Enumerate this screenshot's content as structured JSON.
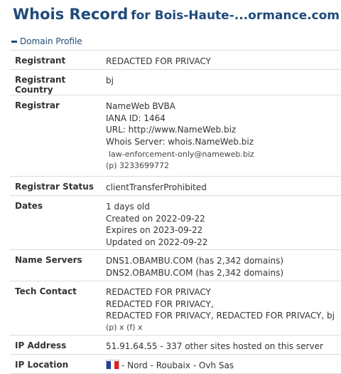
{
  "header": {
    "title": "Whois Record",
    "domain": "for Bois-Haute-...ormance.com"
  },
  "section": {
    "label": "Domain Profile"
  },
  "rows": {
    "registrant": {
      "label": "Registrant",
      "value": "REDACTED FOR PRIVACY"
    },
    "registrant_country": {
      "label": "Registrant Country",
      "value": "bj"
    },
    "registrar": {
      "label": "Registrar",
      "name": "NameWeb BVBA",
      "iana": "IANA ID: 1464",
      "url": "URL: http://www.NameWeb.biz",
      "whois": "Whois Server: whois.NameWeb.biz",
      "email": "law-enforcement-only@nameweb.biz",
      "phone": "(p)  3233699772"
    },
    "status": {
      "label": "Registrar Status",
      "value": "clientTransferProhibited"
    },
    "dates": {
      "label": "Dates",
      "age": "1 days old",
      "created": "Created on 2022-09-22",
      "expires": "Expires on 2023-09-22",
      "updated": "Updated on 2022-09-22"
    },
    "name_servers": {
      "label": "Name Servers",
      "ns1": "DNS1.OBAMBU.COM (has 2,342 domains)",
      "ns2": "DNS2.OBAMBU.COM (has 2,342 domains)"
    },
    "tech_contact": {
      "label": "Tech Contact",
      "line1": "REDACTED FOR PRIVACY",
      "line2": "REDACTED FOR PRIVACY,",
      "line3": "REDACTED FOR PRIVACY, REDACTED FOR PRIVACY, bj",
      "line4": "(p)  x   (f)  x"
    },
    "ip_address": {
      "label": "IP Address",
      "value": "51.91.64.55 - 337 other sites hosted on this server"
    },
    "ip_location": {
      "label": "IP Location",
      "value": "- Nord - Roubaix - Ovh Sas"
    }
  },
  "colors": {
    "heading": "#1f4a7a",
    "border": "#dcdcdc"
  }
}
